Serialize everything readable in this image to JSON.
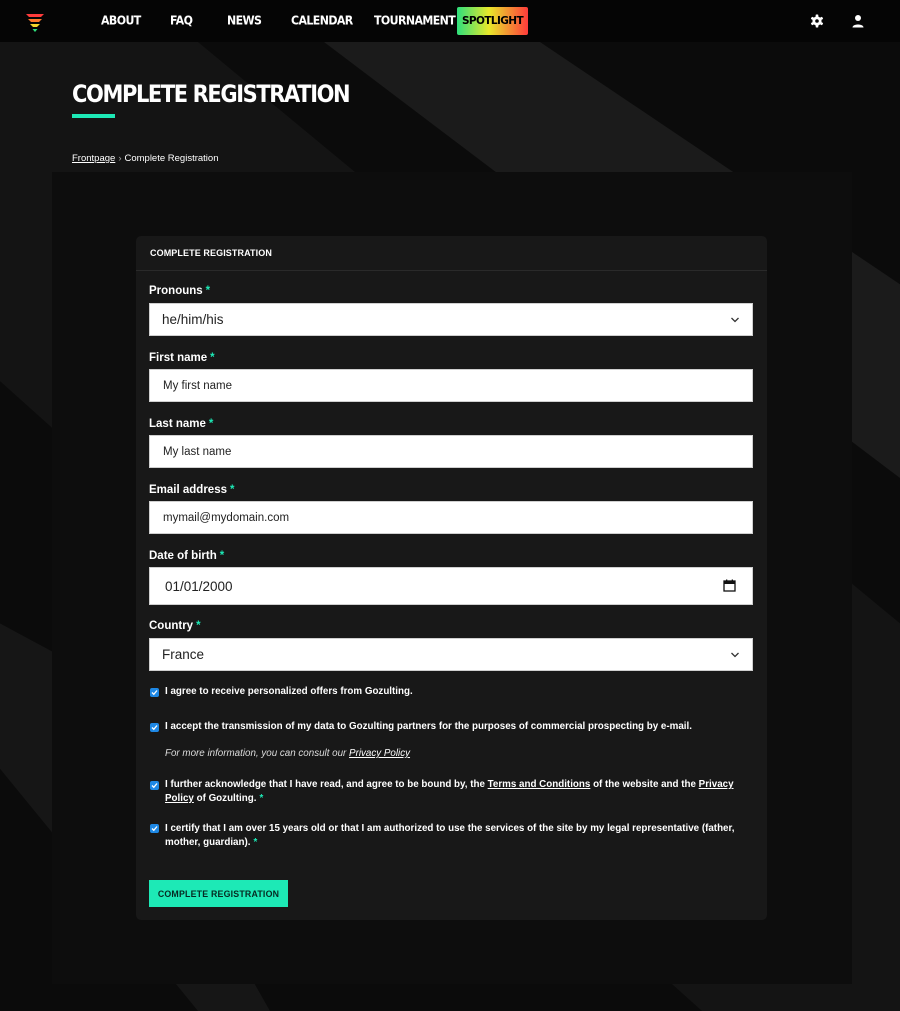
{
  "nav": {
    "items": [
      {
        "label": "ABOUT"
      },
      {
        "label": "FAQ"
      },
      {
        "label": "NEWS"
      },
      {
        "label": "CALENDAR"
      },
      {
        "label": "TOURNAMENT"
      }
    ],
    "spotlight_label": "SPOTLIGHT",
    "icons": [
      "gear-icon",
      "user-icon"
    ]
  },
  "page": {
    "title": "COMPLETE REGISTRATION",
    "accent_color": "#1de9b6"
  },
  "breadcrumb": {
    "home": "Frontpage",
    "separator": "›",
    "current": "Complete Registration"
  },
  "form": {
    "header": "COMPLETE REGISTRATION",
    "required_mark": "*",
    "pronouns": {
      "label": "Pronouns",
      "value": "he/him/his"
    },
    "first_name": {
      "label": "First name",
      "placeholder": "My first name"
    },
    "last_name": {
      "label": "Last name",
      "placeholder": "My last name"
    },
    "email": {
      "label": "Email address",
      "placeholder": "mymail@mydomain.com"
    },
    "dob": {
      "label": "Date of birth",
      "value": "01/01/2000"
    },
    "country": {
      "label": "Country",
      "value": "France"
    },
    "checkboxes": {
      "offers": {
        "checked": true,
        "text": "I agree to receive personalized offers from Gozulting."
      },
      "partners": {
        "checked": true,
        "text": "I accept the transmission of my data to Gozulting partners for the purposes of commercial prospecting by e-mail."
      },
      "info_prefix": "For more information, you can consult our ",
      "info_link": "Privacy Policy",
      "terms": {
        "checked": true,
        "text_1": "I further acknowledge that I have read, and agree to be bound by, the ",
        "link_terms": "Terms and Conditions",
        "text_2": " of the website and the ",
        "link_privacy": "Privacy Policy",
        "text_3": " of Gozulting."
      },
      "age": {
        "checked": true,
        "text": "I certify that I am over 15 years old or that I am authorized to use the services of the site by my legal representative (father, mother, guardian)."
      }
    },
    "submit_label": "COMPLETE REGISTRATION"
  }
}
